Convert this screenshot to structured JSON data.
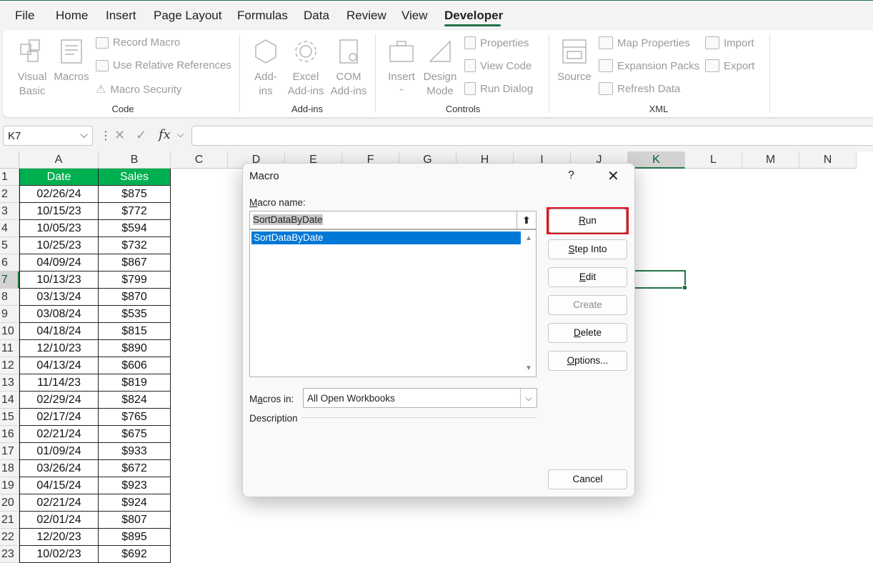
{
  "menu": {
    "tabs": [
      "File",
      "Home",
      "Insert",
      "Page Layout",
      "Formulas",
      "Data",
      "Review",
      "View",
      "Developer"
    ],
    "active": "Developer"
  },
  "ribbon": {
    "code": {
      "group_label": "Code",
      "visual_basic": [
        "Visual",
        "Basic"
      ],
      "macros": "Macros",
      "record_macro": "Record Macro",
      "use_relative": "Use Relative References",
      "macro_security": "Macro Security"
    },
    "addins": {
      "group_label": "Add-ins",
      "addins": [
        "Add-",
        "ins"
      ],
      "excel_addins": [
        "Excel",
        "Add-ins"
      ],
      "com_addins": [
        "COM",
        "Add-ins"
      ]
    },
    "controls": {
      "group_label": "Controls",
      "insert": "Insert",
      "design_mode": [
        "Design",
        "Mode"
      ],
      "properties": "Properties",
      "view_code": "View Code",
      "run_dialog": "Run Dialog"
    },
    "xml": {
      "group_label": "XML",
      "source": "Source",
      "map_properties": "Map Properties",
      "expansion_packs": "Expansion Packs",
      "refresh_data": "Refresh Data",
      "import": "Import",
      "export": "Export"
    }
  },
  "formula_bar": {
    "name_box": "K7",
    "fx": "fx",
    "formula": ""
  },
  "grid": {
    "columns": [
      "A",
      "B",
      "C",
      "D",
      "E",
      "F",
      "G",
      "H",
      "I",
      "J",
      "K",
      "L",
      "M",
      "N"
    ],
    "selected_column": "K",
    "selected_row": "7",
    "headers": [
      "Date",
      "Sales"
    ],
    "rows": [
      [
        "02/26/24",
        "$875"
      ],
      [
        "10/15/23",
        "$772"
      ],
      [
        "10/05/23",
        "$594"
      ],
      [
        "10/25/23",
        "$732"
      ],
      [
        "04/09/24",
        "$867"
      ],
      [
        "10/13/23",
        "$799"
      ],
      [
        "03/13/24",
        "$870"
      ],
      [
        "03/08/24",
        "$535"
      ],
      [
        "04/18/24",
        "$815"
      ],
      [
        "12/10/23",
        "$890"
      ],
      [
        "04/13/24",
        "$606"
      ],
      [
        "11/14/23",
        "$819"
      ],
      [
        "02/29/24",
        "$824"
      ],
      [
        "02/17/24",
        "$765"
      ],
      [
        "02/21/24",
        "$675"
      ],
      [
        "01/09/24",
        "$933"
      ],
      [
        "03/26/24",
        "$672"
      ],
      [
        "04/15/24",
        "$923"
      ],
      [
        "02/21/24",
        "$924"
      ],
      [
        "02/01/24",
        "$807"
      ],
      [
        "12/20/23",
        "$895"
      ],
      [
        "10/02/23",
        "$692"
      ]
    ]
  },
  "dialog": {
    "title": "Macro",
    "help": "?",
    "close": "✕",
    "macro_name_label_u": "M",
    "macro_name_label_rest": "acro name:",
    "macro_name_value": "SortDataByDate",
    "list_items": [
      "SortDataByDate"
    ],
    "buttons": {
      "run_u": "R",
      "run_rest": "un",
      "step_into_u": "S",
      "step_into_rest": "tep Into",
      "edit_u": "E",
      "edit_rest": "dit",
      "create": "Create",
      "delete_u": "D",
      "delete_rest": "elete",
      "options_u": "O",
      "options_rest": "ptions...",
      "cancel": "Cancel"
    },
    "macros_in_label_pre": "M",
    "macros_in_label_u": "a",
    "macros_in_label_rest": "cros in:",
    "macros_in_value": "All Open Workbooks",
    "description_label": "Description"
  }
}
